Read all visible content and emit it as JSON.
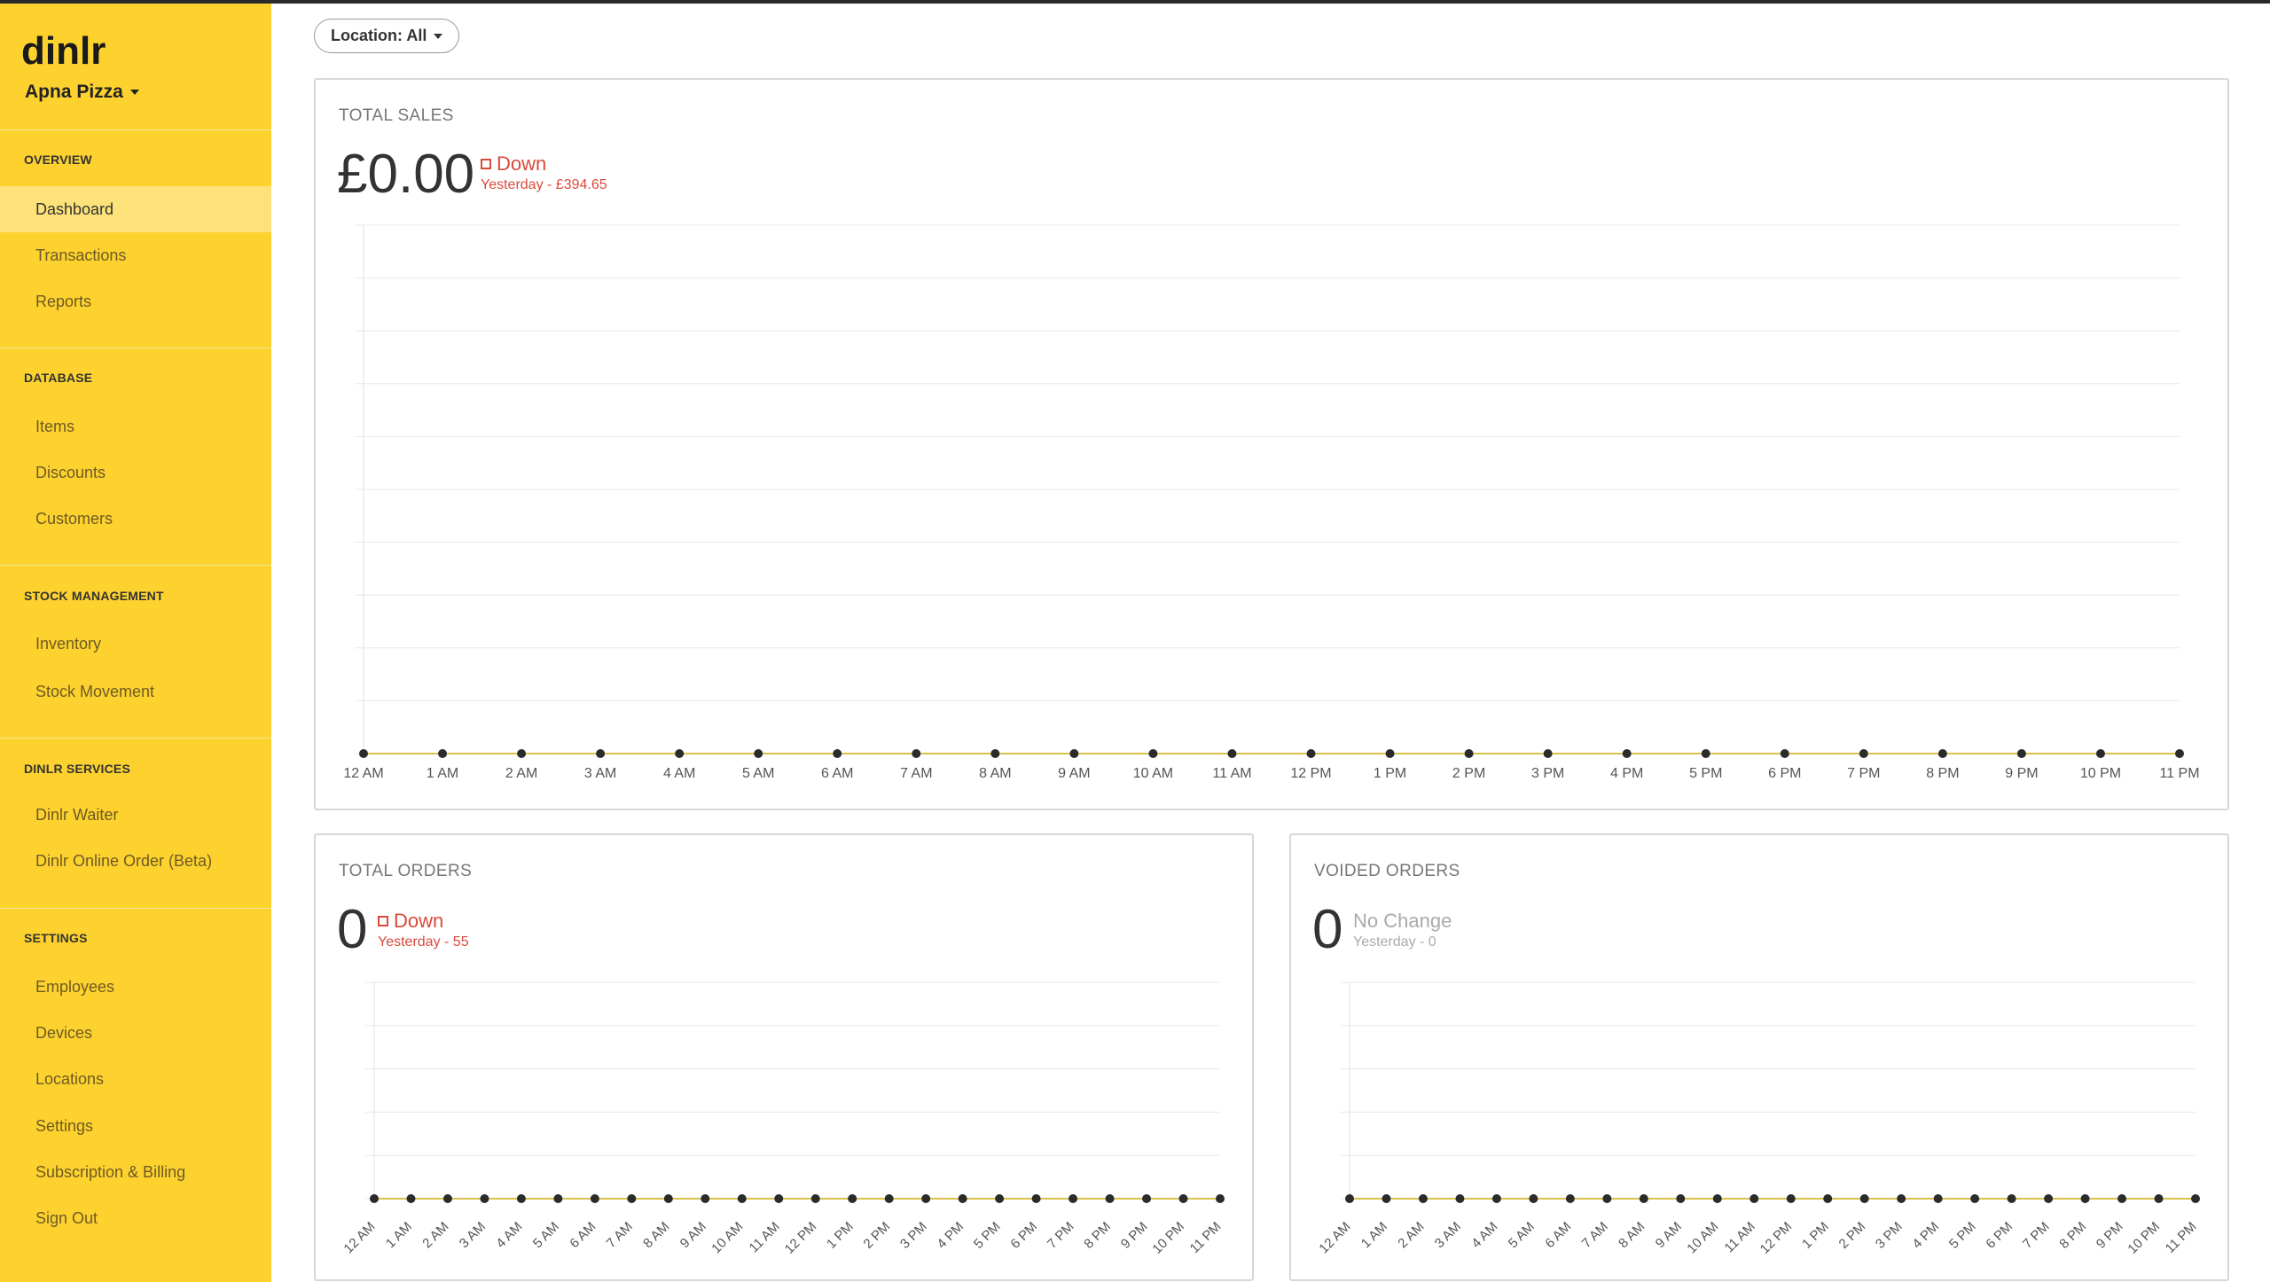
{
  "brand": {
    "logo_text": "dinlr",
    "restaurant": "Apna Pizza"
  },
  "sidebar": {
    "sections": [
      {
        "title": "OVERVIEW",
        "items": [
          "Dashboard",
          "Transactions",
          "Reports"
        ]
      },
      {
        "title": "DATABASE",
        "items": [
          "Items",
          "Discounts",
          "Customers"
        ]
      },
      {
        "title": "STOCK MANAGEMENT",
        "items": [
          "Inventory",
          "Stock Movement"
        ]
      },
      {
        "title": "DINLR SERVICES",
        "items": [
          "Dinlr Waiter",
          "Dinlr Online Order (Beta)"
        ]
      },
      {
        "title": "SETTINGS",
        "items": [
          "Employees",
          "Devices",
          "Locations",
          "Settings",
          "Subscription & Billing",
          "Sign Out"
        ]
      }
    ],
    "active_item": "Dashboard"
  },
  "filter": {
    "location_label": "Location: All"
  },
  "total_sales": {
    "title": "TOTAL SALES",
    "value": "£0.00",
    "trend": "Down",
    "comparison": "Yesterday - £394.65"
  },
  "total_orders": {
    "title": "TOTAL ORDERS",
    "value": "0",
    "trend": "Down",
    "comparison": "Yesterday - 55"
  },
  "voided_orders": {
    "title": "VOIDED ORDERS",
    "value": "0",
    "trend": "No Change",
    "comparison": "Yesterday - 0"
  },
  "colors": {
    "sidebar": "#fdd22f",
    "accent_line": "#d9c24a",
    "down": "#d94a3b"
  },
  "chart_data": [
    {
      "type": "line",
      "title": "TOTAL SALES",
      "x": [
        "12 AM",
        "1 AM",
        "2 AM",
        "3 AM",
        "4 AM",
        "5 AM",
        "6 AM",
        "7 AM",
        "8 AM",
        "9 AM",
        "10 AM",
        "11 AM",
        "12 PM",
        "1 PM",
        "2 PM",
        "3 PM",
        "4 PM",
        "5 PM",
        "6 PM",
        "7 PM",
        "8 PM",
        "9 PM",
        "10 PM",
        "11 PM"
      ],
      "series": [
        {
          "values": [
            0,
            0,
            0,
            0,
            0,
            0,
            0,
            0,
            0,
            0,
            0,
            0,
            0,
            0,
            0,
            0,
            0,
            0,
            0,
            0,
            0,
            0,
            0,
            0
          ]
        }
      ],
      "grid": true
    },
    {
      "type": "line",
      "title": "TOTAL ORDERS",
      "x": [
        "12 AM",
        "1 AM",
        "2 AM",
        "3 AM",
        "4 AM",
        "5 AM",
        "6 AM",
        "7 AM",
        "8 AM",
        "9 AM",
        "10 AM",
        "11 AM",
        "12 PM",
        "1 PM",
        "2 PM",
        "3 PM",
        "4 PM",
        "5 PM",
        "6 PM",
        "7 PM",
        "8 PM",
        "9 PM",
        "10 PM",
        "11 PM"
      ],
      "series": [
        {
          "values": [
            0,
            0,
            0,
            0,
            0,
            0,
            0,
            0,
            0,
            0,
            0,
            0,
            0,
            0,
            0,
            0,
            0,
            0,
            0,
            0,
            0,
            0,
            0,
            0
          ]
        }
      ],
      "grid": true
    },
    {
      "type": "line",
      "title": "VOIDED ORDERS",
      "x": [
        "12 AM",
        "1 AM",
        "2 AM",
        "3 AM",
        "4 AM",
        "5 AM",
        "6 AM",
        "7 AM",
        "8 AM",
        "9 AM",
        "10 AM",
        "11 AM",
        "12 PM",
        "1 PM",
        "2 PM",
        "3 PM",
        "4 PM",
        "5 PM",
        "6 PM",
        "7 PM",
        "8 PM",
        "9 PM",
        "10 PM",
        "11 PM"
      ],
      "series": [
        {
          "values": [
            0,
            0,
            0,
            0,
            0,
            0,
            0,
            0,
            0,
            0,
            0,
            0,
            0,
            0,
            0,
            0,
            0,
            0,
            0,
            0,
            0,
            0,
            0,
            0
          ]
        }
      ],
      "grid": true
    }
  ]
}
